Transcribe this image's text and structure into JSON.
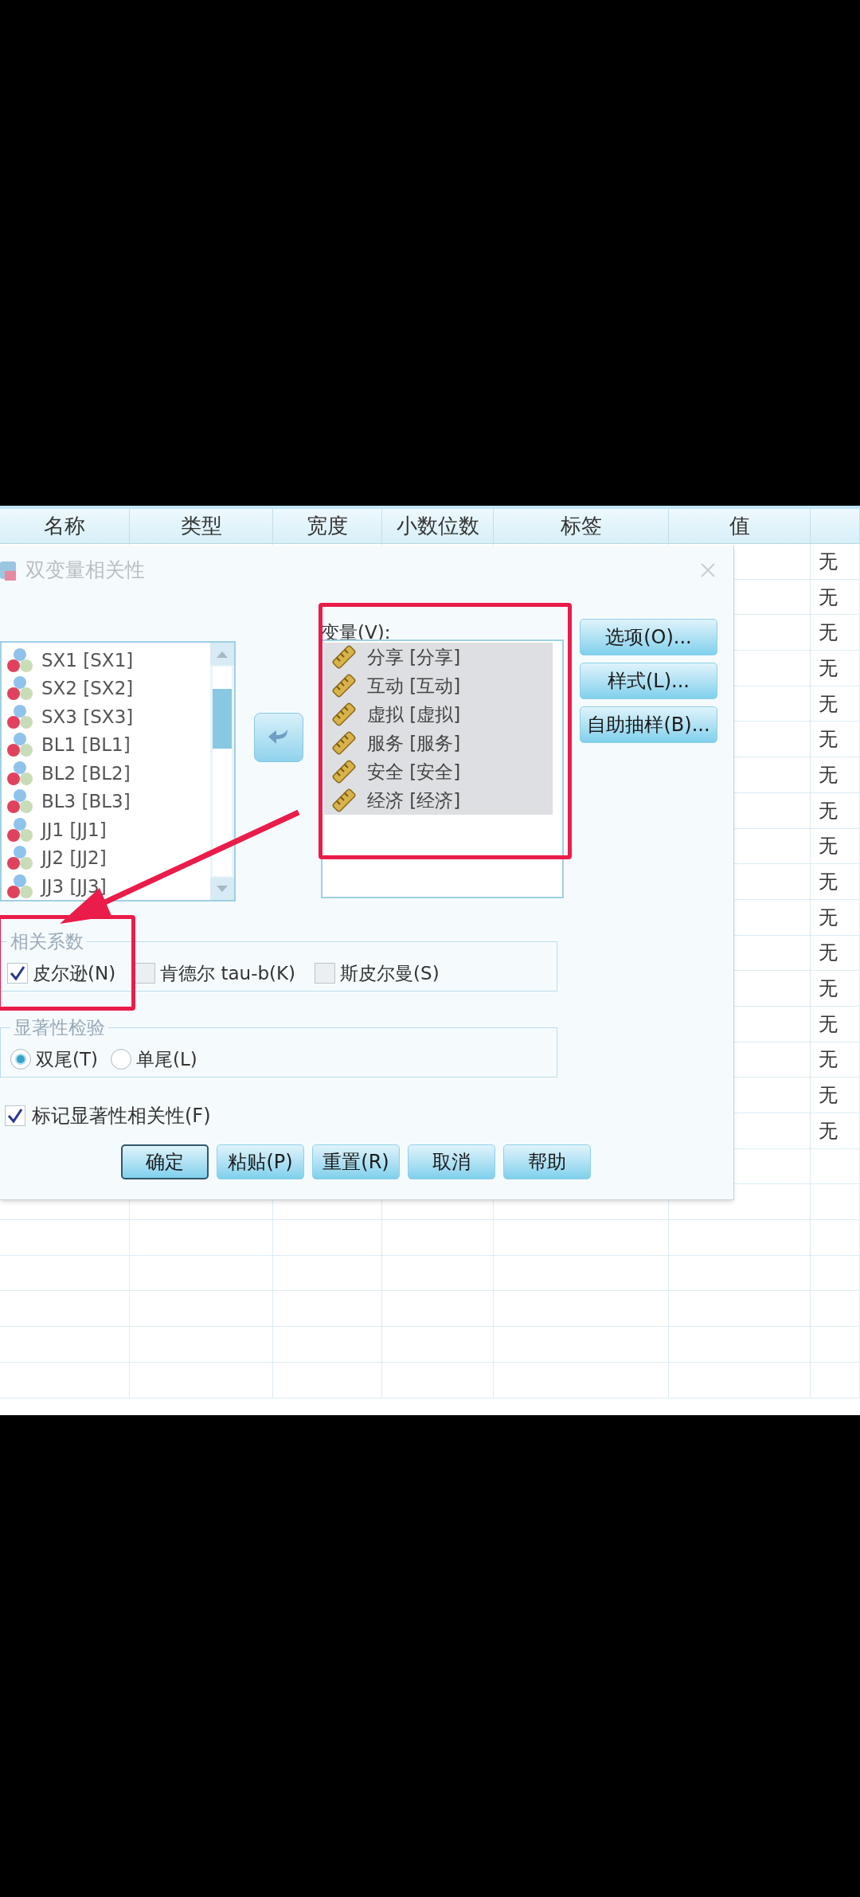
{
  "grid": {
    "columns": [
      "名称",
      "类型",
      "宽度",
      "小数位数",
      "标签",
      "值"
    ],
    "last_column_cells": [
      "无",
      "无",
      "无",
      "无",
      "无",
      "无",
      "无",
      "无",
      "无",
      "无",
      "无",
      "无",
      "无",
      "无",
      "无",
      "无",
      "无"
    ]
  },
  "dialog": {
    "title": "双变量相关性",
    "source_list": [
      {
        "label": "SX1 [SX1]",
        "selected": false
      },
      {
        "label": "SX2 [SX2]",
        "selected": false
      },
      {
        "label": "SX3 [SX3]",
        "selected": false
      },
      {
        "label": "BL1 [BL1]",
        "selected": false
      },
      {
        "label": "BL2 [BL2]",
        "selected": false
      },
      {
        "label": "BL3 [BL3]",
        "selected": false
      },
      {
        "label": "JJ1 [JJ1]",
        "selected": false
      },
      {
        "label": "JJ2 [JJ2]",
        "selected": false
      },
      {
        "label": "JJ3 [JJ3]",
        "selected": false
      }
    ],
    "variables_label": "变量(V):",
    "variables": [
      {
        "label": "分享 [分享]",
        "selected": true
      },
      {
        "label": "互动 [互动]",
        "selected": true
      },
      {
        "label": "虚拟 [虚拟]",
        "selected": true
      },
      {
        "label": "服务 [服务]",
        "selected": true
      },
      {
        "label": "安全 [安全]",
        "selected": true
      },
      {
        "label": "经济 [经济]",
        "selected": true
      }
    ],
    "side_buttons": [
      "选项(O)...",
      "样式(L)...",
      "自助抽样(B)..."
    ],
    "correlation": {
      "title": "相关系数",
      "options": [
        {
          "label": "皮尔逊(N)",
          "checked": true
        },
        {
          "label": "肯德尔 tau-b(K)",
          "checked": false
        },
        {
          "label": "斯皮尔曼(S)",
          "checked": false
        }
      ]
    },
    "significance": {
      "title": "显著性检验",
      "options": [
        {
          "label": "双尾(T)",
          "selected": true
        },
        {
          "label": "单尾(L)",
          "selected": false
        }
      ]
    },
    "flag_significant": {
      "label": "标记显著性相关性(F)",
      "checked": true
    },
    "buttons": [
      {
        "label": "确定",
        "default": true
      },
      {
        "label": "粘贴(P)",
        "default": false
      },
      {
        "label": "重置(R)",
        "default": false
      },
      {
        "label": "取消",
        "default": false
      },
      {
        "label": "帮助",
        "default": false
      }
    ]
  }
}
